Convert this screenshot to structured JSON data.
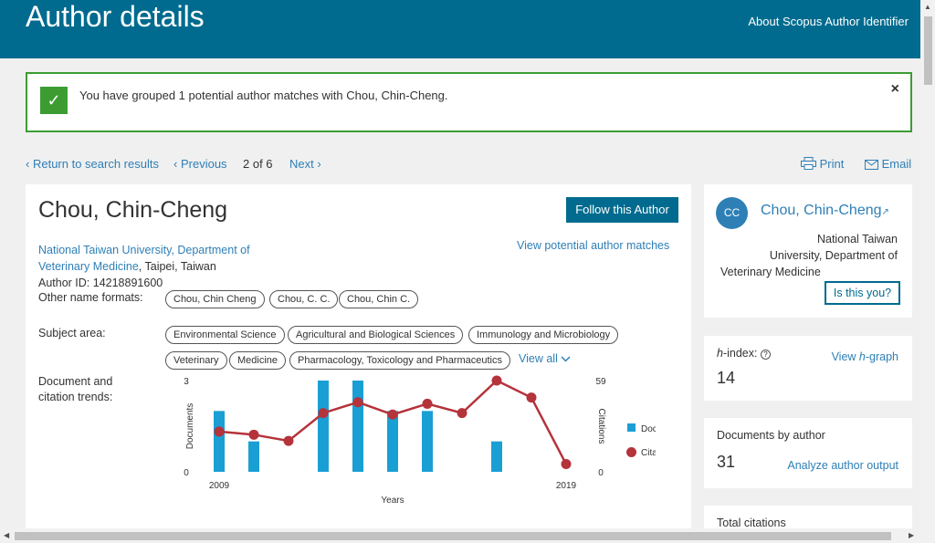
{
  "header": {
    "title": "Author details",
    "about_link": "About Scopus Author Identifier"
  },
  "alert": {
    "message": "You have grouped 1 potential author matches with Chou, Chin-Cheng.",
    "close": "×"
  },
  "nav": {
    "return": "Return to search results",
    "previous": "Previous",
    "position": "2 of 6",
    "next": "Next",
    "print": "Print",
    "email": "Email"
  },
  "author": {
    "name": "Chou, Chin-Cheng",
    "follow_label": "Follow this Author",
    "affiliation_line1": "National Taiwan University, Department of",
    "affiliation_line2": "Veterinary Medicine",
    "location": ", Taipei, Taiwan",
    "author_id": "Author ID: 14218891600",
    "view_matches": "View potential author matches",
    "other_names_label": "Other name formats:",
    "other_names": [
      "Chou, Chin Cheng",
      "Chou, C. C.",
      "Chou, Chin C."
    ],
    "subject_label": "Subject area:",
    "subjects": [
      "Environmental Science",
      "Agricultural and Biological Sciences",
      "Immunology and Microbiology",
      "Veterinary",
      "Medicine",
      "Pharmacology, Toxicology and Pharmaceutics"
    ],
    "view_all": "View all",
    "trends_label_1": "Document and",
    "trends_label_2": "citation trends:"
  },
  "chart_data": {
    "type": "bar+line",
    "x": [
      2009,
      2010,
      2011,
      2012,
      2013,
      2014,
      2015,
      2016,
      2017,
      2018,
      2019
    ],
    "x_ticks": [
      "2009",
      "2019"
    ],
    "xlabel": "Years",
    "series": [
      {
        "name": "Documents",
        "type": "bar",
        "axis": "left",
        "color": "#1a9fd4",
        "values": [
          2,
          1,
          0,
          3,
          3,
          2,
          2,
          0,
          1,
          0,
          0
        ]
      },
      {
        "name": "Citations",
        "type": "line",
        "axis": "right",
        "color": "#b5333b",
        "values": [
          26,
          24,
          20,
          38,
          45,
          37,
          44,
          38,
          59,
          48,
          5
        ]
      }
    ],
    "ylabel_left": "Documents",
    "ylabel_right": "Citations",
    "ylim_left": [
      0,
      3
    ],
    "ylim_right": [
      0,
      59
    ],
    "ylim_left_ticks": [
      "0",
      "3"
    ],
    "ylim_right_ticks": [
      "0",
      "59"
    ],
    "legend": "right"
  },
  "profile": {
    "initials": "CC",
    "name": "Chou, Chin-Cheng",
    "affil_1": "National Taiwan",
    "affil_2": "University, Department of",
    "affil_3": "Veterinary Medicine",
    "is_this_you": "Is this you?"
  },
  "hindex": {
    "label": "-index:",
    "prefix": "h",
    "value": "14",
    "link_prefix": "View ",
    "link_h": "h",
    "link_suffix": "-graph"
  },
  "documents": {
    "label": "Documents by author",
    "value": "31",
    "link": "Analyze author output"
  },
  "citations": {
    "label": "Total citations"
  },
  "colors": {
    "header": "#006b8f",
    "link": "#2e7fb6",
    "success": "#3c9c32"
  }
}
